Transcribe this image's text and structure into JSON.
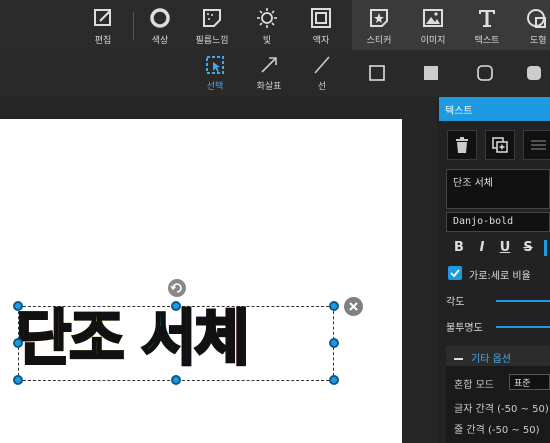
{
  "toolbar": {
    "tools": [
      {
        "label": "편집",
        "icon": "edit-icon"
      },
      {
        "label": "색상",
        "icon": "color-circle-icon"
      },
      {
        "label": "필름느낌",
        "icon": "film-icon"
      },
      {
        "label": "빛",
        "icon": "light-icon"
      },
      {
        "label": "액자",
        "icon": "frame-icon"
      },
      {
        "label": "스티커",
        "icon": "sticker-icon"
      },
      {
        "label": "이미지",
        "icon": "image-icon"
      },
      {
        "label": "텍스트",
        "icon": "text-icon"
      },
      {
        "label": "도형",
        "icon": "shape-icon"
      }
    ]
  },
  "subbar": {
    "items": [
      {
        "label": "선택",
        "icon": "select-icon",
        "active": true
      },
      {
        "label": "화살표",
        "icon": "arrow-icon"
      },
      {
        "label": "선",
        "icon": "line-icon"
      },
      {
        "label": "",
        "icon": "square-outline-icon"
      },
      {
        "label": "",
        "icon": "square-filled-icon"
      },
      {
        "label": "",
        "icon": "rounded-square-icon"
      },
      {
        "label": "",
        "icon": "rounded-square-filled-icon"
      }
    ]
  },
  "panel": {
    "header": "텍스트",
    "text_value": "단조 서체",
    "font_value": "Danjo-bold",
    "format_buttons": [
      "B",
      "I",
      "U",
      "S"
    ],
    "aspect_ratio_label": "가로:세로 비율",
    "angle_label": "각도",
    "opacity_label": "불투명도",
    "more_options_label": "기타 옵션",
    "blend_mode_label": "혼합 모드",
    "blend_mode_value": "표준",
    "letter_spacing_label": "글자 간격 (-50 ~ 50)",
    "line_spacing_label": "줄 간격 (-50 ~ 50)"
  },
  "canvas": {
    "text_object": "단조 서체"
  },
  "colors": {
    "accent": "#1e9ae0",
    "panel_bg": "#222222",
    "toolbar_bg": "#2b2b2b"
  }
}
